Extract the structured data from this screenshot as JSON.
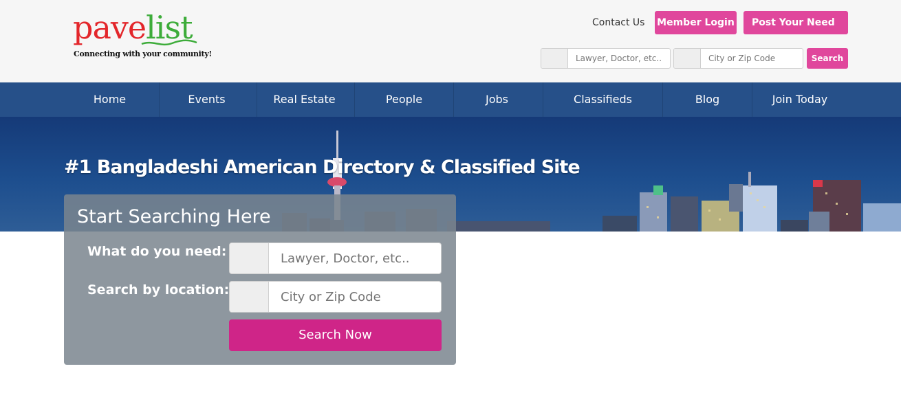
{
  "header": {
    "logo": {
      "part1": "pave",
      "part2": "list",
      "tagline": "Connecting with your community!"
    },
    "contact_link": "Contact Us",
    "member_login": "Member Login",
    "post_need": "Post Your Need",
    "post_need_caret": "",
    "mini_search": {
      "what_icon": "",
      "what_placeholder": "Lawyer, Doctor, etc..",
      "where_icon": "",
      "where_placeholder": "City or Zip Code",
      "button": "Search"
    },
    "colors": {
      "background": "#f6f6f6",
      "accent_pink": "#e0479c"
    }
  },
  "nav": {
    "color": "#265089",
    "items": [
      {
        "label": "Home",
        "caret": ""
      },
      {
        "label": "Events",
        "caret": ""
      },
      {
        "label": "Real Estate",
        "caret": ""
      },
      {
        "label": "People",
        "caret": ""
      },
      {
        "label": "Jobs",
        "caret": ""
      },
      {
        "label": "Classifieds",
        "caret": ""
      },
      {
        "label": "Blog",
        "caret": ""
      },
      {
        "label": "Join Today",
        "caret": ""
      }
    ]
  },
  "hero": {
    "title": "#1 Bangladeshi American Directory & Classified Site"
  },
  "search_panel": {
    "title": "Start Searching Here",
    "what_label": "What do you need:",
    "what_icon": "",
    "what_placeholder": "Lawyer, Doctor, etc..",
    "location_label": "Search by location:",
    "location_icon": "",
    "location_placeholder": "City or Zip Code",
    "submit": "Search Now",
    "submit_color": "#cf2588"
  }
}
